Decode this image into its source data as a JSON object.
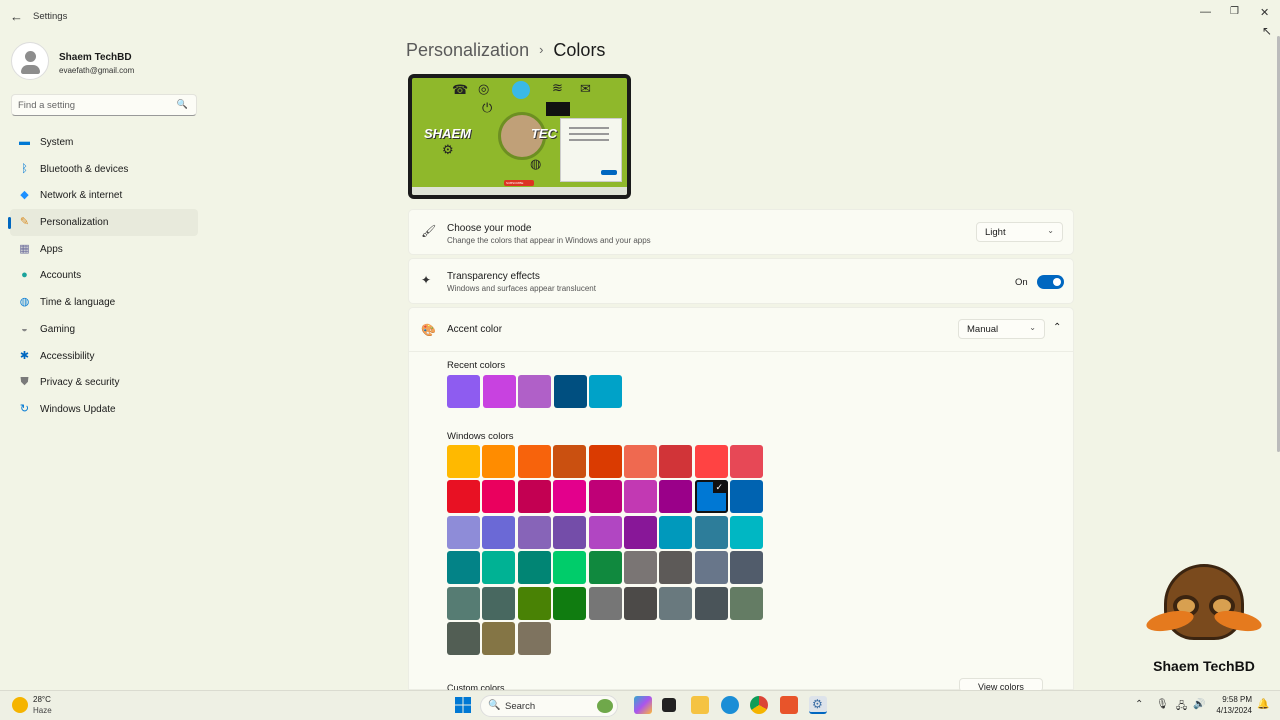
{
  "window": {
    "title": "Settings",
    "back_icon": "back-arrow-icon",
    "controls": [
      "minimize-icon",
      "restore-icon",
      "close-icon"
    ]
  },
  "profile": {
    "name": "Shaem TechBD",
    "email": "evaefath@gmail.com"
  },
  "search": {
    "placeholder": "Find a setting"
  },
  "nav": {
    "items": [
      {
        "label": "System",
        "icon": "monitor-icon",
        "color": "#0078d4"
      },
      {
        "label": "Bluetooth & devices",
        "icon": "bluetooth-icon",
        "color": "#0078d4"
      },
      {
        "label": "Network & internet",
        "icon": "wifi-icon",
        "color": "#1e90ff"
      },
      {
        "label": "Personalization",
        "icon": "brush-icon",
        "color": "#d88a1e"
      },
      {
        "label": "Apps",
        "icon": "apps-icon",
        "color": "#6a6a9a"
      },
      {
        "label": "Accounts",
        "icon": "account-icon",
        "color": "#1ba39c"
      },
      {
        "label": "Time & language",
        "icon": "globe-clock-icon",
        "color": "#0078d4"
      },
      {
        "label": "Gaming",
        "icon": "gamepad-icon",
        "color": "#888888"
      },
      {
        "label": "Accessibility",
        "icon": "accessibility-icon",
        "color": "#0067c0"
      },
      {
        "label": "Privacy & security",
        "icon": "shield-icon",
        "color": "#7a7a7a"
      },
      {
        "label": "Windows Update",
        "icon": "update-icon",
        "color": "#0078d4"
      }
    ],
    "active": "Personalization"
  },
  "breadcrumb": {
    "parent": "Personalization",
    "separator": "›",
    "current": "Colors"
  },
  "preview": {
    "brand_text": "SHAEM",
    "brand_text2": "TEC",
    "subscribe": "SUBSCRIBE"
  },
  "mode": {
    "title": "Choose your mode",
    "subtitle": "Change the colors that appear in Windows and your apps",
    "value": "Light"
  },
  "transparency": {
    "title": "Transparency effects",
    "subtitle": "Windows and surfaces appear translucent",
    "state_label": "On",
    "on": true
  },
  "accent": {
    "title": "Accent color",
    "value": "Manual",
    "expanded": true
  },
  "recent_colors": {
    "label": "Recent colors",
    "colors": [
      "#8e5cf0",
      "#c842e0",
      "#b060c8",
      "#004f80",
      "#00a2c8"
    ]
  },
  "windows_colors": {
    "label": "Windows colors",
    "selected": "#0063b1",
    "rows": [
      [
        "#ffb900",
        "#ff8c00",
        "#f7630c",
        "#ca5010",
        "#da3b01",
        "#ef6950",
        "#d13438",
        "#ff4343",
        "#e74856"
      ],
      [
        "#e81123",
        "#ea005e",
        "#c30052",
        "#e3008c",
        "#bf0077",
        "#c239b3",
        "#9a0089",
        "#0063b1",
        "#0063b1"
      ],
      [
        "#8e8cd8",
        "#6b69d6",
        "#8764b8",
        "#744da9",
        "#b146c2",
        "#881798",
        "#0099bc",
        "#2d7d9a",
        "#00b7c3"
      ],
      [
        "#038387",
        "#00b294",
        "#018574",
        "#00cc6a",
        "#10893e",
        "#7a7574",
        "#5d5a58",
        "#68768a",
        "#515c6b"
      ],
      [
        "#567c73",
        "#486860",
        "#498205",
        "#107c10",
        "#767676",
        "#4c4a48",
        "#69797e",
        "#4a5459",
        "#647c64"
      ],
      [
        "#525e54",
        "#847545",
        "#7e735f"
      ]
    ]
  },
  "custom_colors": {
    "label": "Custom colors",
    "button": "View colors"
  },
  "taskbar": {
    "weather_temp": "28°C",
    "weather_desc": "Haze",
    "search_label": "Search",
    "time": "9:58 PM",
    "date": "4/13/2024"
  },
  "watermark": {
    "text": "Shaem TechBD"
  }
}
